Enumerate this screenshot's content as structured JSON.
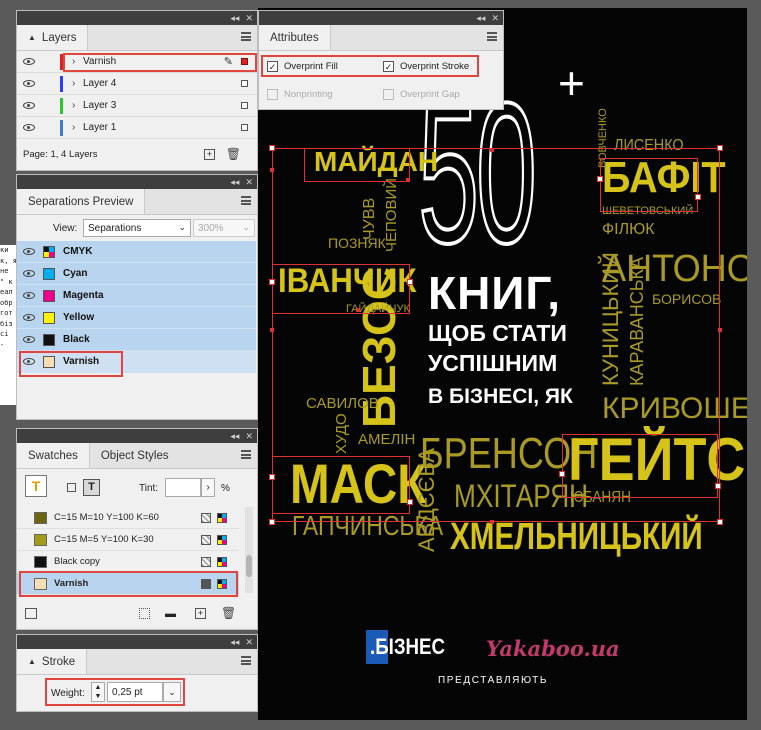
{
  "layers_panel": {
    "tab": "Layers",
    "rows": [
      {
        "name": "Varnish",
        "color": "#e02020"
      },
      {
        "name": "Layer 4",
        "color": "#2a3cff"
      },
      {
        "name": "Layer 3",
        "color": "#2ec82e"
      },
      {
        "name": "Layer 1",
        "color": "#3d7bd6"
      }
    ],
    "footer": "Page: 1, 4 Layers"
  },
  "attributes_panel": {
    "tab": "Attributes",
    "overprint_fill": "Overprint Fill",
    "overprint_stroke": "Overprint Stroke",
    "nonprinting": "Nonprinting",
    "overprint_gap": "Overprint Gap"
  },
  "separations_panel": {
    "tab": "Separations Preview",
    "view_label": "View:",
    "view_value": "Separations",
    "zoom": "300%",
    "rows": [
      {
        "name": "CMYK",
        "color": "cmyk"
      },
      {
        "name": "Cyan",
        "color": "#00aeef"
      },
      {
        "name": "Magenta",
        "color": "#ec008c"
      },
      {
        "name": "Yellow",
        "color": "#fff200"
      },
      {
        "name": "Black",
        "color": "#111111"
      },
      {
        "name": "Varnish",
        "color": "#f5deb3"
      }
    ]
  },
  "swatches_panel": {
    "tab_swatches": "Swatches",
    "tab_object_styles": "Object Styles",
    "tint_label": "Tint:",
    "tint_unit": "%",
    "rows": [
      {
        "name": "C=15 M=10 Y=100 K=60",
        "color": "#6a6410"
      },
      {
        "name": "C=15 M=5 Y=100 K=30",
        "color": "#a39c1a"
      },
      {
        "name": "Black copy",
        "color": "#111111"
      },
      {
        "name": "Varnish",
        "color": "#f5deb3"
      }
    ]
  },
  "stroke_panel": {
    "tab": "Stroke",
    "weight_label": "Weight:",
    "weight_value": "0,25 pt"
  },
  "left_strip": [
    "ки",
    "к, я",
    "не",
    "\" к",
    "еал",
    "обр",
    "гот",
    "біз",
    "сі",
    "-"
  ],
  "cover": {
    "numeral": "50",
    "plus": "+",
    "line1": "КНИГ,",
    "line2": "ЩОБ СТАТИ",
    "line3": "УСПІШНИМ",
    "line4": "В БІЗНЕСІ, ЯК",
    "names": {
      "maidan": "МАЙДАН",
      "bafit": "БАФІТ",
      "ivanchyk": "ІВАНЧИК",
      "antonov": "АНТОНОВ",
      "bezos": "БЕЗОС",
      "kryvoshea": "КРИВОШЕЯ",
      "mask": "МАСК",
      "brenson": "БРЕНСОН",
      "geits": "ГЕЙТС",
      "mkhitarian": "МХІТАРЯН",
      "khmelnytskyi": "ХМЕЛЬНИЦЬКИЙ",
      "gapchynska": "ГАПЧИНСЬКА",
      "avdeeva": "АВДЄЄВА",
      "yubanian": "ЮБАНЯН",
      "lysenko": "ЛИСЕНКО",
      "vovchenko": "ВОВЧЕНКО",
      "shevetovskyi": "ШЕВЕТОВСЬКИЙ",
      "filiuk": "ФІЛЮК",
      "borysov": "БОРИСОВ",
      "kunytskyi": "КУНИЦЬКИЙ",
      "karavanska": "КАРАВАНСЬКА",
      "chuvv": "ЧУВВ",
      "chepovyi": "ЧЕПОВИЙ",
      "pozniak": "ПОЗНЯК",
      "haidaichuk": "ГАЙДАЙЧУК",
      "savylov": "САВИЛОВ",
      "khudo": "ХУДО",
      "amelin": "АМЕЛІН"
    },
    "publisher_biznes": ".БІЗНЕС",
    "publisher_yakaboo": "Yakaboo.ua",
    "presents": "ПРЕДСТАВЛЯЮТЬ"
  },
  "colors": {
    "selection": "#e03030",
    "highlight_box": "#e0463f",
    "row_selected": "#b9d4ef",
    "cover_yellow": "#d6c31a"
  }
}
